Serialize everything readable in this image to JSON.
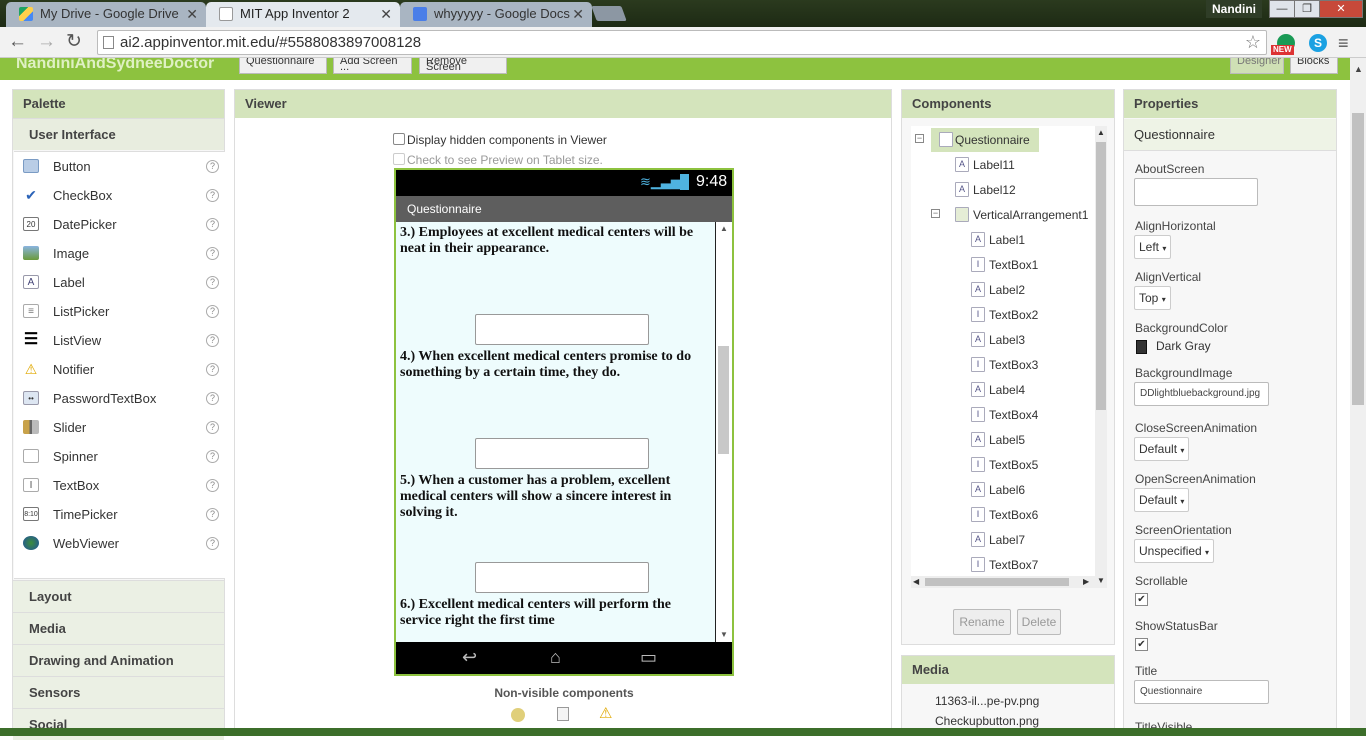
{
  "browser": {
    "tabs": [
      {
        "title": "My Drive - Google Drive",
        "active": false
      },
      {
        "title": "MIT App Inventor 2",
        "active": true
      },
      {
        "title": "whyyyyy - Google Docs",
        "active": false
      }
    ],
    "user": "Nandini",
    "url": "ai2.appinventor.mit.edu/#5588083897008128",
    "ext_badge": "NEW"
  },
  "app": {
    "project_name": "NandiniAndSydneeDoctor",
    "screen_select": "Questionnaire",
    "add_screen": "Add Screen ...",
    "remove_screen": "Remove Screen",
    "designer": "Designer",
    "blocks": "Blocks"
  },
  "palette": {
    "title": "Palette",
    "active_category": "User Interface",
    "items": [
      {
        "label": "Button",
        "icon": "button-icon"
      },
      {
        "label": "CheckBox",
        "icon": "checkbox-icon"
      },
      {
        "label": "DatePicker",
        "icon": "datepicker-icon"
      },
      {
        "label": "Image",
        "icon": "image-icon"
      },
      {
        "label": "Label",
        "icon": "label-icon"
      },
      {
        "label": "ListPicker",
        "icon": "listpicker-icon"
      },
      {
        "label": "ListView",
        "icon": "listview-icon"
      },
      {
        "label": "Notifier",
        "icon": "notifier-icon"
      },
      {
        "label": "PasswordTextBox",
        "icon": "password-icon"
      },
      {
        "label": "Slider",
        "icon": "slider-icon"
      },
      {
        "label": "Spinner",
        "icon": "spinner-icon"
      },
      {
        "label": "TextBox",
        "icon": "textbox-icon"
      },
      {
        "label": "TimePicker",
        "icon": "timepicker-icon"
      },
      {
        "label": "WebViewer",
        "icon": "webviewer-icon"
      }
    ],
    "categories": [
      "Layout",
      "Media",
      "Drawing and Animation",
      "Sensors",
      "Social"
    ]
  },
  "viewer": {
    "title": "Viewer",
    "hidden_label": "Display hidden components in Viewer",
    "tablet_label": "Check to see Preview on Tablet size.",
    "phone": {
      "time": "9:48",
      "title": "Questionnaire",
      "questions": [
        "3.) Employees at excellent medical centers will be neat in their appearance.",
        "4.) When excellent medical centers promise to do something by a certain time, they do.",
        "5.) When a customer has a problem, excellent medical centers will show a sincere interest in solving it.",
        "6.) Excellent medical centers will perform the service right the first time"
      ]
    },
    "nonvisible_title": "Non-visible components"
  },
  "components": {
    "title": "Components",
    "tree": [
      {
        "name": "Questionnaire",
        "type": "screen",
        "level": 0,
        "selected": true
      },
      {
        "name": "Label11",
        "type": "label",
        "level": 1
      },
      {
        "name": "Label12",
        "type": "label",
        "level": 1
      },
      {
        "name": "VerticalArrangement1",
        "type": "arrangement",
        "level": 1
      },
      {
        "name": "Label1",
        "type": "label",
        "level": 2
      },
      {
        "name": "TextBox1",
        "type": "textbox",
        "level": 2
      },
      {
        "name": "Label2",
        "type": "label",
        "level": 2
      },
      {
        "name": "TextBox2",
        "type": "textbox",
        "level": 2
      },
      {
        "name": "Label3",
        "type": "label",
        "level": 2
      },
      {
        "name": "TextBox3",
        "type": "textbox",
        "level": 2
      },
      {
        "name": "Label4",
        "type": "label",
        "level": 2
      },
      {
        "name": "TextBox4",
        "type": "textbox",
        "level": 2
      },
      {
        "name": "Label5",
        "type": "label",
        "level": 2
      },
      {
        "name": "TextBox5",
        "type": "textbox",
        "level": 2
      },
      {
        "name": "Label6",
        "type": "label",
        "level": 2
      },
      {
        "name": "TextBox6",
        "type": "textbox",
        "level": 2
      },
      {
        "name": "Label7",
        "type": "label",
        "level": 2
      },
      {
        "name": "TextBox7",
        "type": "textbox",
        "level": 2
      }
    ],
    "rename": "Rename",
    "delete": "Delete"
  },
  "media": {
    "title": "Media",
    "items": [
      "11363-il...pe-pv.png",
      "Checkupbutton.png"
    ]
  },
  "properties": {
    "title": "Properties",
    "component": "Questionnaire",
    "about_label": "AboutScreen",
    "align_h_label": "AlignHorizontal",
    "align_h_value": "Left",
    "align_v_label": "AlignVertical",
    "align_v_value": "Top",
    "bg_color_label": "BackgroundColor",
    "bg_color_value": "Dark Gray",
    "bg_image_label": "BackgroundImage",
    "bg_image_value": "DDlightbluebackground.jpg",
    "close_anim_label": "CloseScreenAnimation",
    "close_anim_value": "Default",
    "open_anim_label": "OpenScreenAnimation",
    "open_anim_value": "Default",
    "orientation_label": "ScreenOrientation",
    "orientation_value": "Unspecified",
    "scrollable_label": "Scrollable",
    "statusbar_label": "ShowStatusBar",
    "title_label": "Title",
    "title_value": "Questionnaire",
    "title_visible_label": "TitleVisible"
  },
  "colors": {
    "accent": "#8dc23f",
    "screen_bg": "#eefcfd",
    "swatch": "#333333"
  }
}
